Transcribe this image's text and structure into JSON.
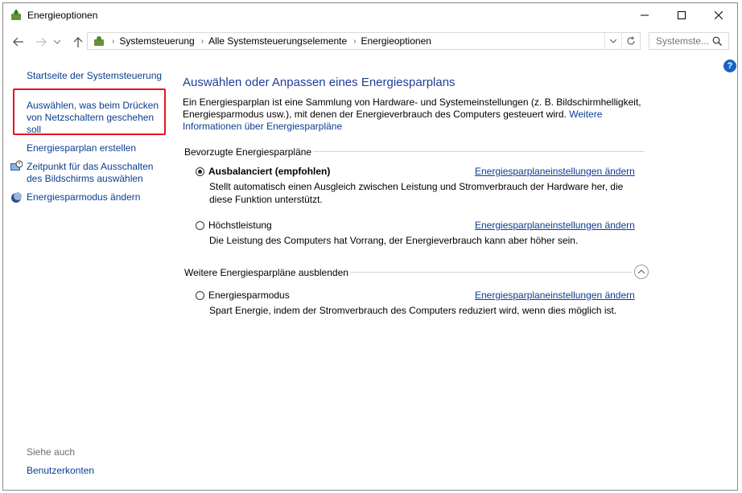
{
  "window": {
    "title": "Energieoptionen"
  },
  "addressbar": {
    "crumbs": [
      "Systemsteuerung",
      "Alle Systemsteuerungselemente",
      "Energieoptionen"
    ],
    "search_placeholder": "Systemste..."
  },
  "sidebar": {
    "items": [
      {
        "label": "Startseite der Systemsteuerung"
      },
      {
        "label": "Auswählen, was beim Drücken von Netzschaltern geschehen soll"
      },
      {
        "label": "Energiesparplan erstellen"
      },
      {
        "label": "Zeitpunkt für das Ausschalten des Bildschirms auswählen"
      },
      {
        "label": "Energiesparmodus ändern"
      }
    ],
    "see_also": "Siehe auch",
    "see_also_items": [
      {
        "label": "Benutzerkonten"
      }
    ]
  },
  "main": {
    "title": "Auswählen oder Anpassen eines Energiesparplans",
    "intro": "Ein Energiesparplan ist eine Sammlung von Hardware- und Systemeinstellungen (z. B. Bildschirmhelligkeit, Energiesparmodus usw.), mit denen der Energieverbrauch des Computers gesteuert wird.",
    "intro_link": "Weitere Informationen über Energiesparpläne",
    "preferred_label": "Bevorzugte Energiesparpläne",
    "hidden_label": "Weitere Energiesparpläne ausblenden",
    "plans": [
      {
        "name": "Ausbalanciert (empfohlen)",
        "desc": "Stellt automatisch einen Ausgleich zwischen Leistung und Stromverbrauch der Hardware her, die diese Funktion unterstützt.",
        "link": "Energiesparplaneinstellungen ändern",
        "selected": true
      },
      {
        "name": "Höchstleistung",
        "desc": "Die Leistung des Computers hat Vorrang, der Energieverbrauch kann aber höher sein.",
        "link": "Energiesparplaneinstellungen ändern",
        "selected": false
      },
      {
        "name": "Energiesparmodus",
        "desc": "Spart Energie, indem der Stromverbrauch des Computers reduziert wird, wenn dies möglich ist.",
        "link": "Energiesparplaneinstellungen ändern",
        "selected": false
      }
    ]
  },
  "colors": {
    "link": "#0b3d91",
    "title": "#1e3e9a",
    "highlight_box": "#e81123"
  }
}
